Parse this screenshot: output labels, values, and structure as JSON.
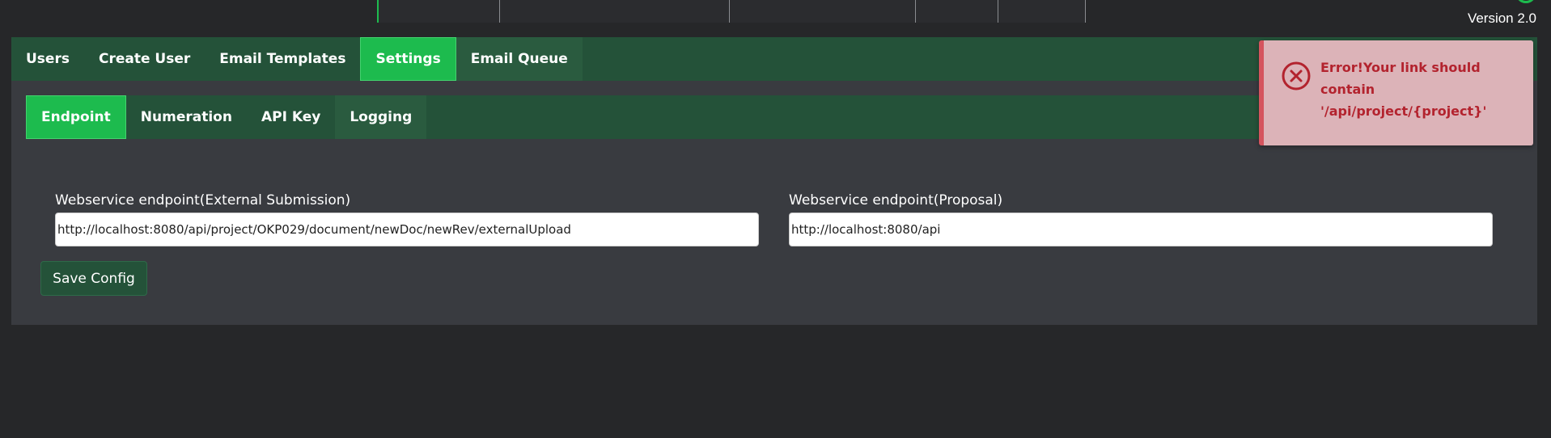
{
  "header": {
    "version": "Version 2.0"
  },
  "main_tabs": [
    {
      "label": "Users",
      "active": false
    },
    {
      "label": "Create User",
      "active": false
    },
    {
      "label": "Email Templates",
      "active": false
    },
    {
      "label": "Settings",
      "active": true
    },
    {
      "label": "Email Queue",
      "active": false
    }
  ],
  "sub_tabs": [
    {
      "label": "Endpoint",
      "active": true
    },
    {
      "label": "Numeration",
      "active": false
    },
    {
      "label": "API Key",
      "active": false
    },
    {
      "label": "Logging",
      "active": false
    }
  ],
  "form": {
    "external": {
      "label": "Webservice endpoint(External Submission)",
      "value": "http://localhost:8080/api/project/OKP029/document/newDoc/newRev/externalUpload"
    },
    "proposal": {
      "label": "Webservice endpoint(Proposal)",
      "value": "http://localhost:8080/api"
    },
    "save_label": "Save Config"
  },
  "toast": {
    "type": "error",
    "message": "Error!Your link should contain '/api/project/{project}'",
    "icon": "close-circle-icon"
  },
  "colors": {
    "accent": "#1dbb4e",
    "nav": "#245239",
    "panel": "#393b40",
    "error": "#b3232e",
    "error_bg": "#dcb3b8"
  }
}
